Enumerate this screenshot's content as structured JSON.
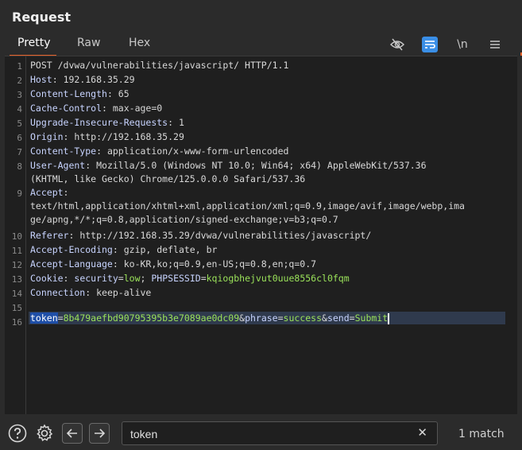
{
  "panel": {
    "title": "Request"
  },
  "tabs": [
    {
      "label": "Pretty",
      "active": true
    },
    {
      "label": "Raw",
      "active": false
    },
    {
      "label": "Hex",
      "active": false
    }
  ],
  "toolbar": {
    "hide_icon": "eye-off-icon",
    "wrap_icon": "word-wrap-icon",
    "newline_label": "\\n",
    "menu_icon": "hamburger-menu-icon"
  },
  "line_numbers": [
    "1",
    "2",
    "3",
    "4",
    "5",
    "6",
    "7",
    "8",
    "9",
    "10",
    "11",
    "12",
    "13",
    "14",
    "15",
    "16"
  ],
  "lines": {
    "l1": "POST /dvwa/vulnerabilities/javascript/ HTTP/1.1",
    "l2_name": "Host",
    "l2_val": "192.168.35.29",
    "l3_name": "Content-Length",
    "l3_val": "65",
    "l4_name": "Cache-Control",
    "l4_val": "max-age=0",
    "l5_name": "Upgrade-Insecure-Requests",
    "l5_val": "1",
    "l6_name": "Origin",
    "l6_val": "http://192.168.35.29",
    "l7_name": "Content-Type",
    "l7_val": "application/x-www-form-urlencoded",
    "l8_name": "User-Agent",
    "l8_val": "Mozilla/5.0 (Windows NT 10.0; Win64; x64) AppleWebKit/537.36",
    "l8_cont": "(KHTML, like Gecko) Chrome/125.0.0.0 Safari/537.36",
    "l9_name": "Accept",
    "l9_cont1": "text/html,application/xhtml+xml,application/xml;q=0.9,image/avif,image/webp,ima",
    "l9_cont2": "ge/apng,*/*;q=0.8,application/signed-exchange;v=b3;q=0.7",
    "l10_name": "Referer",
    "l10_val": "http://192.168.35.29/dvwa/vulnerabilities/javascript/",
    "l11_name": "Accept-Encoding",
    "l11_val": "gzip, deflate, br",
    "l12_name": "Accept-Language",
    "l12_val": "ko-KR,ko;q=0.9,en-US;q=0.8,en;q=0.7",
    "l13_name": "Cookie",
    "l13_c1_name": "security",
    "l13_c1_val": "low",
    "l13_c2_name": "PHPSESSID",
    "l13_c2_val": "kqiogbhejvut0uue8556cl0fqm",
    "l14_name": "Connection",
    "l14_val": "keep-alive",
    "l16_p1_name": "token",
    "l16_p1_val": "8b479aefbd90795395b3e7089ae0dc09",
    "l16_p2_name": "phrase",
    "l16_p2_val": "success",
    "l16_p3_name": "send",
    "l16_p3_val": "Submit"
  },
  "search": {
    "value": "token",
    "clear_icon": "close-icon",
    "match_text": "1 match"
  },
  "bottom_icons": {
    "help": "help-icon",
    "settings": "gear-icon",
    "prev": "arrow-left-icon",
    "next": "arrow-right-icon"
  },
  "colors": {
    "accent": "#e8642c",
    "highlight": "#1f4fa8",
    "param_value": "#9be35a",
    "header_name": "#c8d4ff"
  }
}
